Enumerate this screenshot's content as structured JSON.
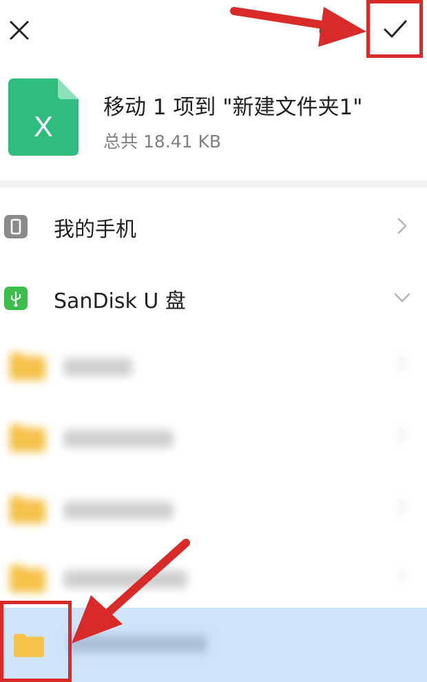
{
  "toolbar": {
    "close_icon": "close-icon",
    "refresh_icon": "refresh-icon",
    "confirm_icon": "check-icon"
  },
  "header": {
    "file_icon_letter": "X",
    "title": "移动 1 项到 \"新建文件夹1\"",
    "subtitle": "总共 18.41 KB"
  },
  "locations": [
    {
      "label": "我的手机",
      "icon": "phone-icon",
      "chevron": "chevron-right-icon"
    },
    {
      "label": "SanDisk U 盘",
      "icon": "usb-icon",
      "chevron": "chevron-down-icon"
    }
  ],
  "folders": [
    {
      "icon": "folder-icon",
      "blurred": true
    },
    {
      "icon": "folder-icon",
      "blurred": true
    },
    {
      "icon": "folder-icon",
      "blurred": true
    },
    {
      "icon": "folder-icon",
      "blurred": true
    },
    {
      "icon": "folder-icon",
      "blurred": true,
      "selected": true
    }
  ],
  "colors": {
    "excel_green": "#2fbd7e",
    "folder_yellow": "#f5c24a",
    "selected_bg": "#cfe3f9",
    "annotation_red": "#d92a2a",
    "usb_green": "#3bbf4c"
  }
}
